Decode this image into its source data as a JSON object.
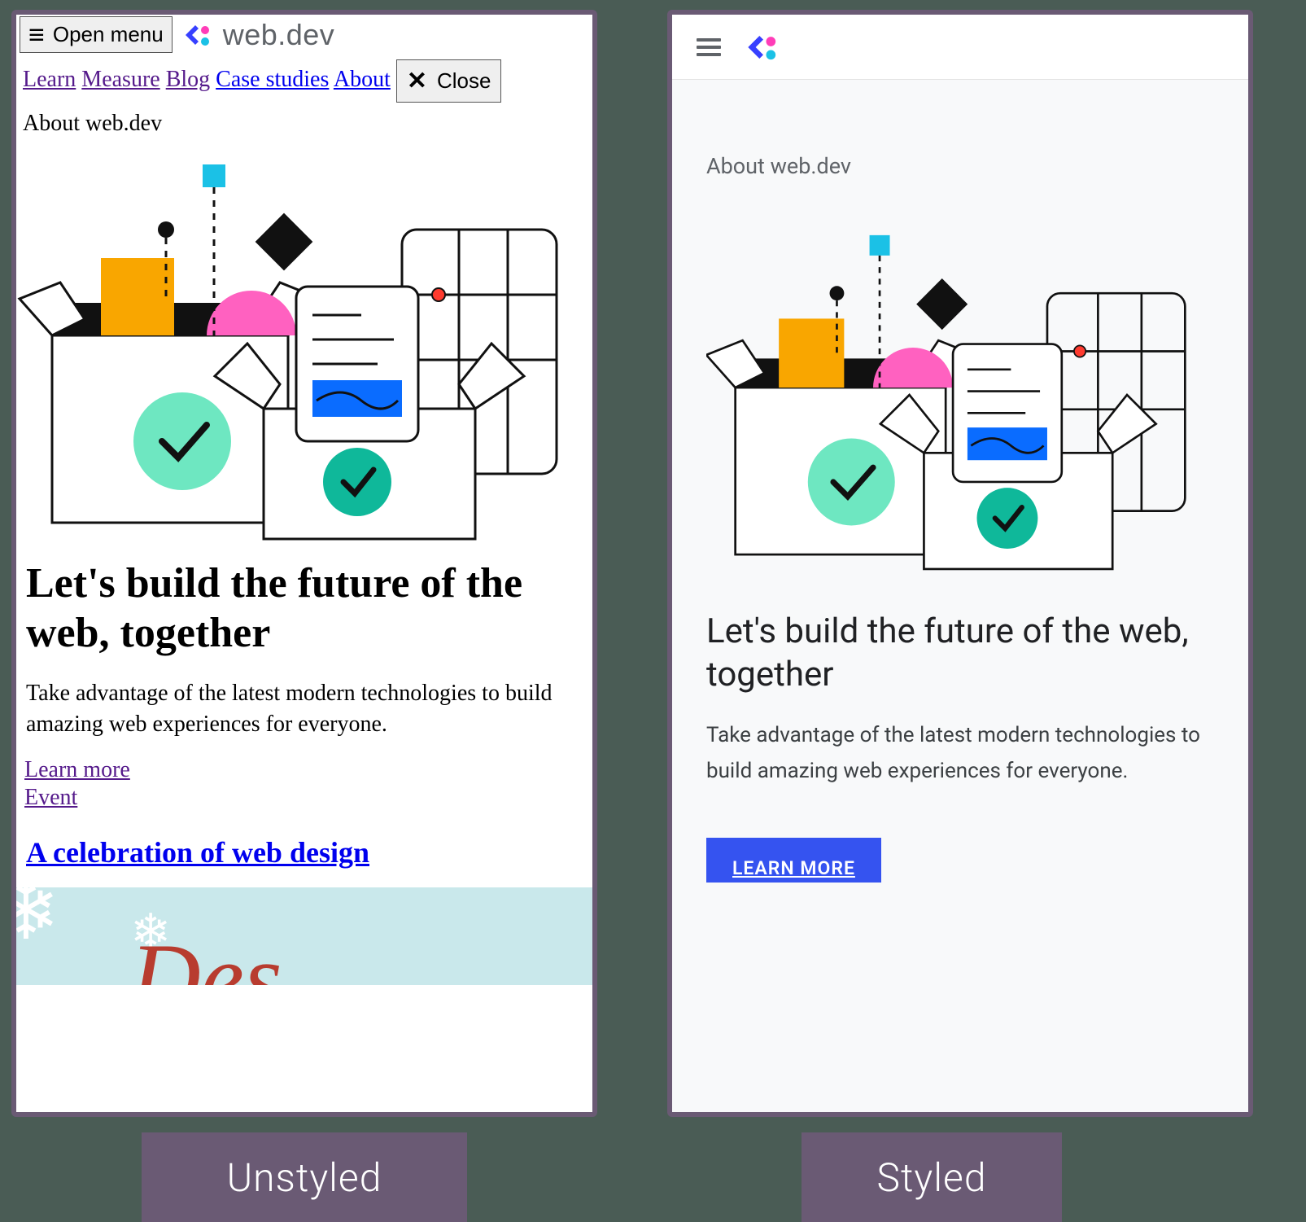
{
  "brand": {
    "name": "web.dev"
  },
  "unstyled": {
    "open_menu": "Open menu",
    "nav": {
      "learn": "Learn",
      "measure": "Measure",
      "blog": "Blog",
      "case_studies": "Case studies",
      "about": "About"
    },
    "close": "Close",
    "eyebrow": "About web.dev",
    "headline": "Let's build the future of the web, together",
    "tagline": "Take advantage of the latest modern technologies to build amazing web experiences for everyone.",
    "learn_more": "Learn more",
    "event": "Event",
    "event_title": "A celebration of web design"
  },
  "styled": {
    "eyebrow": "About web.dev",
    "headline": "Let's build the future of the web, together",
    "tagline": "Take advantage of the latest modern technologies to build amazing web experiences for everyone.",
    "cta": "LEARN MORE"
  },
  "captions": {
    "left": "Unstyled",
    "right": "Styled"
  }
}
